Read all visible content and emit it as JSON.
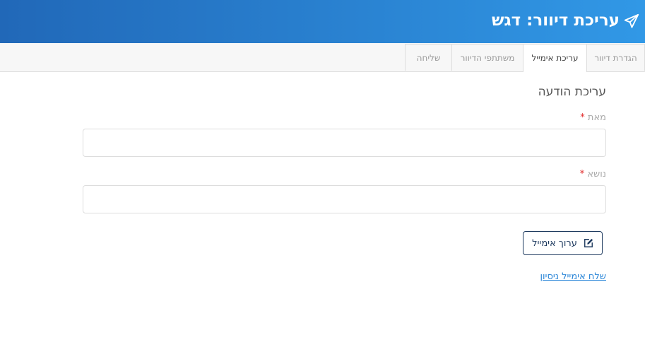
{
  "header": {
    "title": "עריכת דיוור: דגש",
    "icon": "paper-plane-icon"
  },
  "tabs": [
    {
      "label": "הגדרת דיוור",
      "active": false
    },
    {
      "label": "עריכת אימייל",
      "active": true
    },
    {
      "label": "משתתפי הדיוור",
      "active": false
    },
    {
      "label": "שליחה",
      "active": false
    }
  ],
  "form": {
    "section_title": "עריכת הודעה",
    "from_label": "מאת",
    "from_value": "",
    "subject_label": "נושא",
    "subject_value": "",
    "required_mark": "*",
    "edit_button_label": "ערוך אימייל",
    "edit_button_icon": "edit-icon",
    "test_link_label": "שלח אימייל ניסיון"
  },
  "colors": {
    "header_gradient_start": "#2168b8",
    "header_gradient_end": "#3198e6",
    "required": "#e02424",
    "link": "#2b86d8",
    "button_border": "#1e3a5f"
  }
}
